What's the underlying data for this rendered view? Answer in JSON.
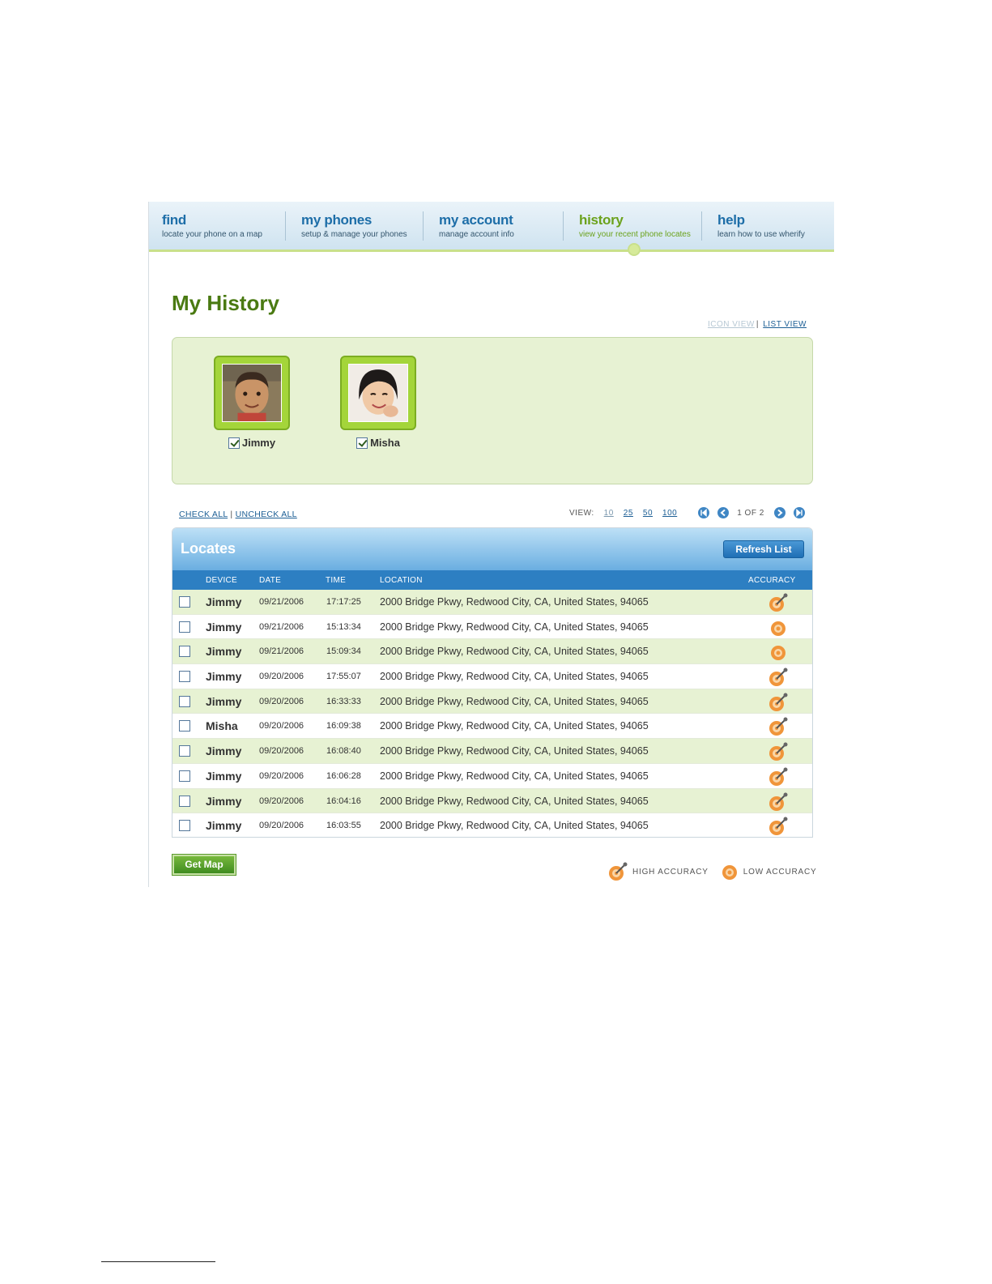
{
  "nav": [
    {
      "title": "find",
      "subtitle": "locate your phone on a map",
      "active": false
    },
    {
      "title": "my phones",
      "subtitle": "setup & manage your phones",
      "active": false
    },
    {
      "title": "my account",
      "subtitle": "manage account info",
      "active": false
    },
    {
      "title": "history",
      "subtitle": "view your recent phone locates",
      "active": true
    },
    {
      "title": "help",
      "subtitle": "learn how to use wherify",
      "active": false
    }
  ],
  "page_title": "My History",
  "view_modes": {
    "icon_view": "ICON VIEW",
    "list_view": "LIST VIEW",
    "separator": "|"
  },
  "devices": [
    {
      "name": "Jimmy",
      "checked": true
    },
    {
      "name": "Misha",
      "checked": true
    }
  ],
  "check_links": {
    "check_all": "CHECK ALL",
    "uncheck_all": "UNCHECK ALL",
    "separator": "|"
  },
  "pager": {
    "label": "VIEW:",
    "sizes": [
      "10",
      "25",
      "50",
      "100"
    ],
    "count": "1 OF 2"
  },
  "locates": {
    "title": "Locates",
    "refresh_label": "Refresh List",
    "columns": {
      "device": "DEVICE",
      "date": "DATE",
      "time": "TIME",
      "location": "LOCATION",
      "accuracy": "ACCURACY"
    },
    "rows": [
      {
        "device": "Jimmy",
        "date": "09/21/2006",
        "time": "17:17:25",
        "location": "2000 Bridge Pkwy, Redwood City, CA, United States, 94065",
        "accuracy": "high"
      },
      {
        "device": "Jimmy",
        "date": "09/21/2006",
        "time": "15:13:34",
        "location": "2000 Bridge Pkwy, Redwood City, CA, United States, 94065",
        "accuracy": "low"
      },
      {
        "device": "Jimmy",
        "date": "09/21/2006",
        "time": "15:09:34",
        "location": "2000 Bridge Pkwy, Redwood City, CA, United States, 94065",
        "accuracy": "low"
      },
      {
        "device": "Jimmy",
        "date": "09/20/2006",
        "time": "17:55:07",
        "location": "2000 Bridge Pkwy, Redwood City, CA, United States, 94065",
        "accuracy": "high"
      },
      {
        "device": "Jimmy",
        "date": "09/20/2006",
        "time": "16:33:33",
        "location": "2000 Bridge Pkwy, Redwood City, CA, United States, 94065",
        "accuracy": "high"
      },
      {
        "device": "Misha",
        "date": "09/20/2006",
        "time": "16:09:38",
        "location": "2000 Bridge Pkwy, Redwood City, CA, United States, 94065",
        "accuracy": "high"
      },
      {
        "device": "Jimmy",
        "date": "09/20/2006",
        "time": "16:08:40",
        "location": "2000 Bridge Pkwy, Redwood City, CA, United States, 94065",
        "accuracy": "high"
      },
      {
        "device": "Jimmy",
        "date": "09/20/2006",
        "time": "16:06:28",
        "location": "2000 Bridge Pkwy, Redwood City, CA, United States, 94065",
        "accuracy": "high"
      },
      {
        "device": "Jimmy",
        "date": "09/20/2006",
        "time": "16:04:16",
        "location": "2000 Bridge Pkwy, Redwood City, CA, United States, 94065",
        "accuracy": "high"
      },
      {
        "device": "Jimmy",
        "date": "09/20/2006",
        "time": "16:03:55",
        "location": "2000 Bridge Pkwy, Redwood City, CA, United States, 94065",
        "accuracy": "high"
      }
    ]
  },
  "get_map_label": "Get Map",
  "legend": {
    "high": "HIGH ACCURACY",
    "low": "LOW ACCURACY"
  },
  "colors": {
    "brand_green": "#4a7a12",
    "nav_blue": "#1d6ea8",
    "accent_orange": "#f0953a"
  }
}
